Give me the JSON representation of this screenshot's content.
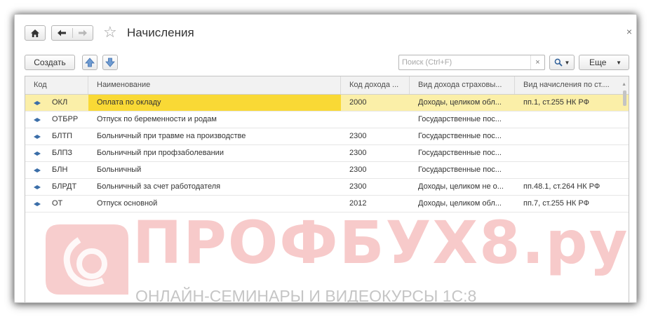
{
  "window": {
    "title": "Начисления",
    "close_glyph": "×"
  },
  "toolbar": {
    "create_label": "Создать",
    "search_placeholder": "Поиск (Ctrl+F)",
    "search_value": "",
    "clear_glyph": "×",
    "more_label": "Еще"
  },
  "table": {
    "columns": [
      "Код",
      "Наименование",
      "Код дохода ...",
      "Вид дохода страховы...",
      "Вид начисления по ст...."
    ],
    "rows": [
      {
        "code": "ОКЛ",
        "name": "Оплата по окладу",
        "income_code": "2000",
        "income_type": "Доходы, целиком обл...",
        "accrual_type": "пп.1, ст.255 НК РФ",
        "selected": true
      },
      {
        "code": "ОТБРР",
        "name": "Отпуск по беременности и родам",
        "income_code": "",
        "income_type": "Государственные пос...",
        "accrual_type": "",
        "selected": false
      },
      {
        "code": "БЛТП",
        "name": "Больничный при травме на производстве",
        "income_code": "2300",
        "income_type": "Государственные пос...",
        "accrual_type": "",
        "selected": false
      },
      {
        "code": "БЛПЗ",
        "name": "Больничный при профзаболевании",
        "income_code": "2300",
        "income_type": "Государственные пос...",
        "accrual_type": "",
        "selected": false
      },
      {
        "code": "БЛН",
        "name": "Больничный",
        "income_code": "2300",
        "income_type": "Государственные пос...",
        "accrual_type": "",
        "selected": false
      },
      {
        "code": "БЛРДТ",
        "name": "Больничный за счет работодателя",
        "income_code": "2300",
        "income_type": "Доходы, целиком не о...",
        "accrual_type": "пп.48.1, ст.264 НК РФ",
        "selected": false
      },
      {
        "code": "ОТ",
        "name": "Отпуск основной",
        "income_code": "2012",
        "income_type": "Доходы, целиком обл...",
        "accrual_type": "пп.7, ст.255 НК РФ",
        "selected": false
      }
    ]
  },
  "watermark": {
    "brand": "ПРОФБУХ8.ру",
    "subtitle": "ОНЛАЙН-СЕМИНАРЫ И ВИДЕОКУРСЫ 1С:8"
  },
  "colors": {
    "selected_row": "#fbefa8",
    "selected_cell": "#f9d935",
    "row_icon": "#3b6ea8"
  }
}
